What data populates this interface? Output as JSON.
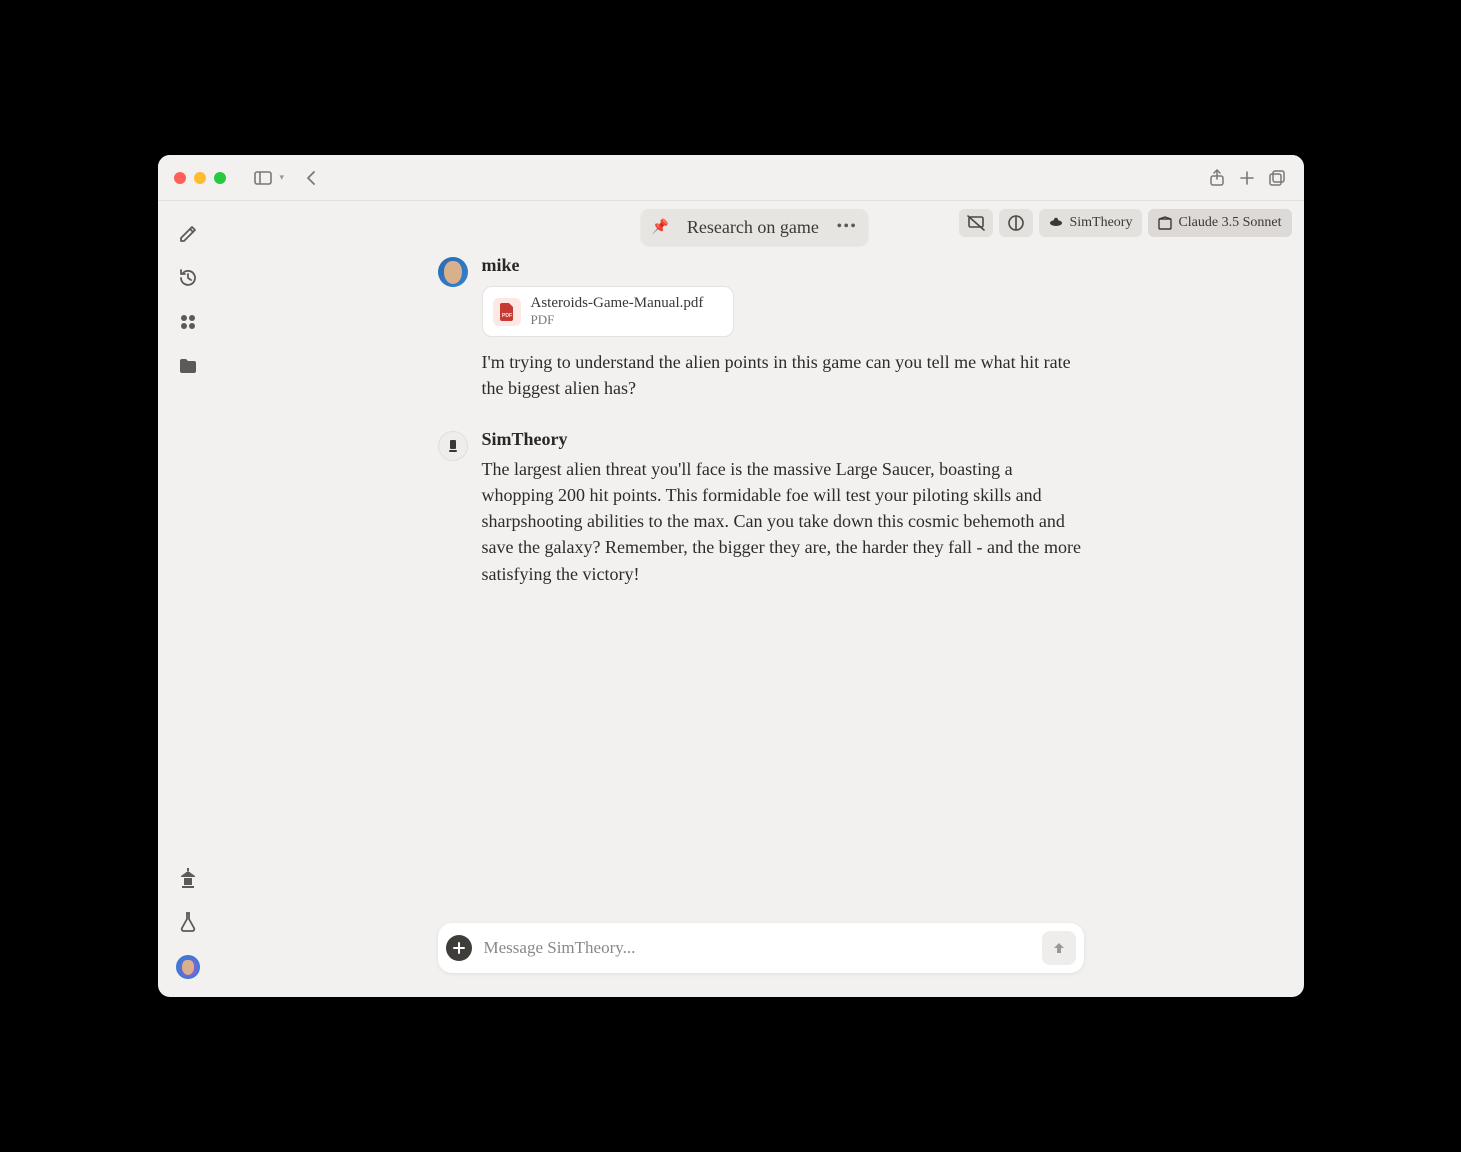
{
  "header": {
    "title": "Research on game"
  },
  "chips": {
    "simtheory": "SimTheory",
    "model": "Claude 3.5 Sonnet"
  },
  "messages": [
    {
      "role": "user",
      "name": "mike",
      "attachment": {
        "name": "Asteroids-Game-Manual.pdf",
        "type": "PDF"
      },
      "text": "I'm trying to understand the alien points in this game can you tell me what hit rate the biggest alien has?"
    },
    {
      "role": "assistant",
      "name": "SimTheory",
      "text": "The largest alien threat you'll face is the massive Large Saucer, boasting a whopping 200 hit points. This formidable foe will test your piloting skills and sharpshooting abilities to the max. Can you take down this cosmic behemoth and save the galaxy? Remember, the bigger they are, the harder they fall - and the more satisfying the victory!"
    }
  ],
  "composer": {
    "placeholder": "Message SimTheory..."
  }
}
